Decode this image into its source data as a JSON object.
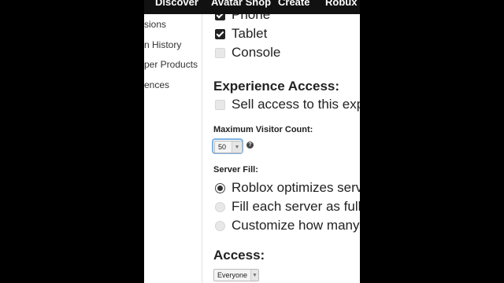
{
  "nav": {
    "items": [
      "Discover",
      "Avatar Shop",
      "Create",
      "Robux"
    ]
  },
  "sidebar": {
    "items": [
      "sions",
      "n History",
      "per Products",
      "ences"
    ]
  },
  "devices": {
    "items": [
      {
        "label": "Phone",
        "checked": true
      },
      {
        "label": "Tablet",
        "checked": true
      },
      {
        "label": "Console",
        "checked": false
      }
    ]
  },
  "experience_access": {
    "heading": "Experience Access:",
    "sell_label": "Sell access to this experien"
  },
  "visitor": {
    "label": "Maximum Visitor Count:",
    "value": "50",
    "help": "?"
  },
  "server_fill": {
    "label": "Server Fill:",
    "options": [
      {
        "label": "Roblox optimizes server fil",
        "selected": true
      },
      {
        "label": "Fill each server as full as p",
        "selected": false
      },
      {
        "label": "Customize how many serv",
        "selected": false
      }
    ]
  },
  "access": {
    "heading": "Access:",
    "value": "Everyone"
  },
  "colors": {
    "focus_ring": "#7fb3e6",
    "nav_bg": "#111111"
  }
}
